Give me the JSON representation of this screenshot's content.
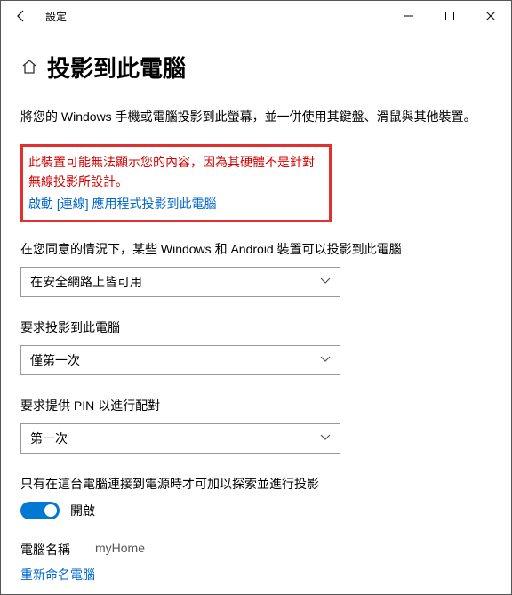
{
  "titlebar": {
    "title": "設定"
  },
  "page": {
    "title": "投影到此電腦"
  },
  "description": "將您的 Windows 手機或電腦投影到此螢幕，並一併使用其鍵盤、滑鼠與其他裝置。",
  "warning": "此裝置可能無法顯示您的內容，因為其硬體不是針對無線投影所設計。",
  "launch_link": "啟動 [連線] 應用程式投影到此電腦",
  "setting1": {
    "label": "在您同意的情況下，某些 Windows 和 Android 裝置可以投影到此電腦",
    "value": "在安全網路上皆可用"
  },
  "setting2": {
    "label": "要求投影到此電腦",
    "value": "僅第一次"
  },
  "setting3": {
    "label": "要求提供 PIN 以進行配對",
    "value": "第一次"
  },
  "setting4": {
    "label": "只有在這台電腦連接到電源時才可加以探索並進行投影",
    "state": "開啟"
  },
  "pcname": {
    "label": "電腦名稱",
    "value": "myHome"
  },
  "rename": "重新命名電腦"
}
